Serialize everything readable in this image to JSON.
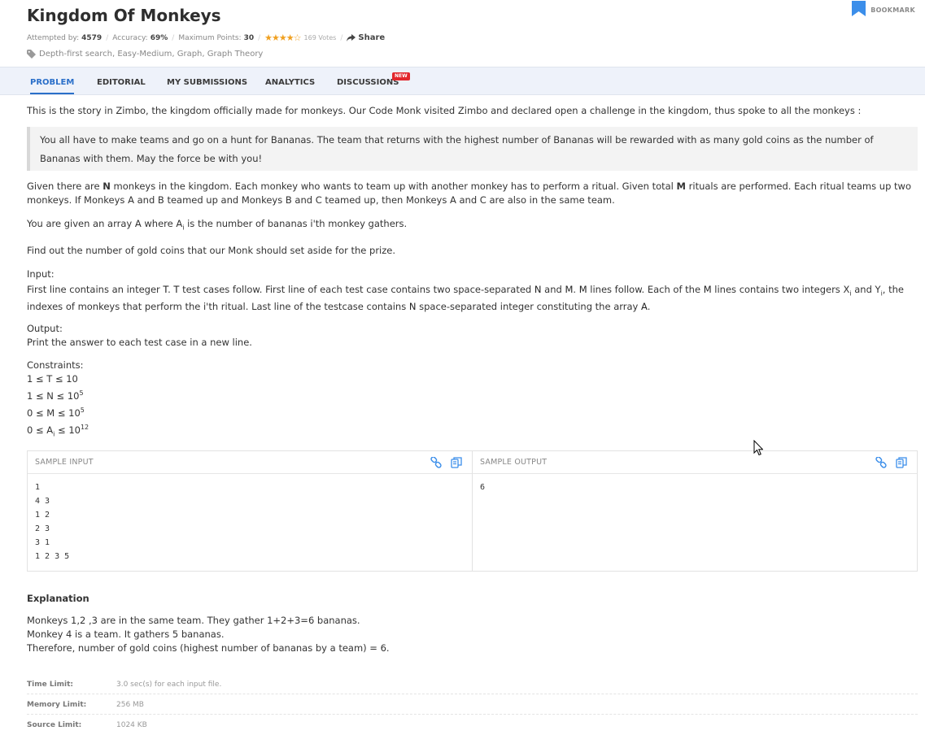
{
  "header": {
    "title": "Kingdom Of Monkeys",
    "bookmark_label": "BOOKMARK",
    "attempted_label": "Attempted by:",
    "attempted_value": "4579",
    "accuracy_label": "Accuracy:",
    "accuracy_value": "69%",
    "max_points_label": "Maximum Points:",
    "max_points_value": "30",
    "rating_stars": 4,
    "votes": "169 Votes",
    "share_label": "Share",
    "tags": "Depth-first search, Easy-Medium, Graph, Graph Theory"
  },
  "tabs": [
    {
      "label": "PROBLEM",
      "active": true
    },
    {
      "label": "EDITORIAL",
      "active": false
    },
    {
      "label": "MY SUBMISSIONS",
      "active": false
    },
    {
      "label": "ANALYTICS",
      "active": false
    },
    {
      "label": "DISCUSSIONS",
      "active": false
    }
  ],
  "tab_badge": "NEW",
  "problem": {
    "intro": "This is the story in Zimbo, the kingdom officially made for monkeys. Our Code Monk visited Zimbo and declared open a challenge in the kingdom, thus spoke to all the monkeys :",
    "quote": "You all have to make teams and go on a hunt for Bananas. The team that returns with the highest number of Bananas will be rewarded with as many gold coins as the number of Bananas with them. May the force be with you!",
    "given_1": "Given there are",
    "given_n": "N",
    "given_2": "monkeys in the kingdom. Each monkey who wants to team up with another monkey has to perform a ritual. Given total",
    "given_m": "M",
    "given_3": "rituals are performed. Each ritual teams up two monkeys. If Monkeys A and B teamed up and Monkeys B and C teamed up, then Monkeys A and C are also in the same team.",
    "array_1": "You are given an array A where A",
    "array_sub": "i",
    "array_2": "is the number of bananas i'th monkey gathers.",
    "find": "Find out the number of gold coins that our Monk should set aside for the prize.",
    "input_label": "Input:",
    "input_1": "First line contains an integer",
    "input_t1": "T",
    "input_2": ".",
    "input_t2": "T",
    "input_3": "test cases follow. First line of each test case contains two space-separated",
    "input_n": "N",
    "input_4": "and",
    "input_m": "M",
    "input_5": ".",
    "input_m2": "M",
    "input_6": "lines follow. Each of the",
    "input_m3": "M",
    "input_7": "lines contains two integers X",
    "input_sub_x": "i",
    "input_8": "and Y",
    "input_sub_y": "i",
    "input_9": ", the indexes of monkeys that perform the i'th ritual. Last line of the testcase contains",
    "input_n2": "N",
    "input_10": "space-separated integer constituting the array",
    "input_a": "A",
    "input_11": ".",
    "output_label": "Output:",
    "output_text": "Print the answer to each test case in a new line.",
    "constraints_label": "Constraints:",
    "c1": "1 ≤ T ≤ 10",
    "c2_a": "1 ≤ N ≤ 10",
    "c2_sup": "5",
    "c3_a": "0 ≤ M ≤ 10",
    "c3_sup": "5",
    "c4_a": "0 ≤ A",
    "c4_sub": "i",
    "c4_b": " ≤ 10",
    "c4_sup": "12"
  },
  "sample": {
    "input_title": "SAMPLE INPUT",
    "input_text": "1\n4 3\n1 2\n2 3\n3 1\n1 2 3 5",
    "output_title": "SAMPLE OUTPUT",
    "output_text": "6"
  },
  "explanation": {
    "title": "Explanation",
    "line1": "Monkeys 1,2 ,3 are in the same team. They gather 1+2+3=6 bananas.",
    "line2": "Monkey 4 is a team. It gathers 5 bananas.",
    "line3": "Therefore, number of gold coins (highest number of bananas by a team) = 6."
  },
  "limits": [
    {
      "label": "Time Limit:",
      "value": "3.0 sec(s) for each input file."
    },
    {
      "label": "Memory Limit:",
      "value": "256 MB"
    },
    {
      "label": "Source Limit:",
      "value": "1024 KB"
    }
  ],
  "colors": {
    "accent": "#2a6fc9",
    "star": "#f0a020",
    "badge": "#e2272c",
    "tabbar_bg": "#eef2fa"
  }
}
